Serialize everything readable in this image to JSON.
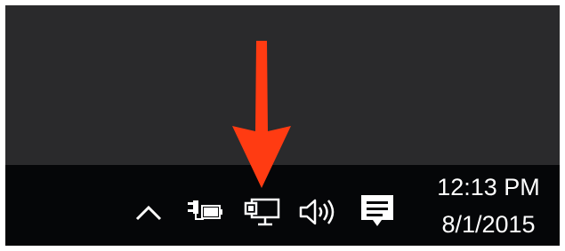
{
  "taskbar": {
    "tray_icons": [
      {
        "name": "show-hidden-icons",
        "icon": "chevron-up-icon"
      },
      {
        "name": "power",
        "icon": "battery-plugged-icon"
      },
      {
        "name": "network",
        "icon": "wired-network-icon"
      },
      {
        "name": "volume",
        "icon": "speaker-icon"
      },
      {
        "name": "action-center",
        "icon": "notification-icon"
      }
    ],
    "clock": {
      "time": "12:13 PM",
      "date": "8/1/2015"
    }
  },
  "annotation": {
    "arrow_color": "#ff3b12",
    "points_to": "wired-network-icon"
  },
  "colors": {
    "desktop": "#2a2a2c",
    "taskbar": "#050608",
    "icon": "#ffffff"
  }
}
